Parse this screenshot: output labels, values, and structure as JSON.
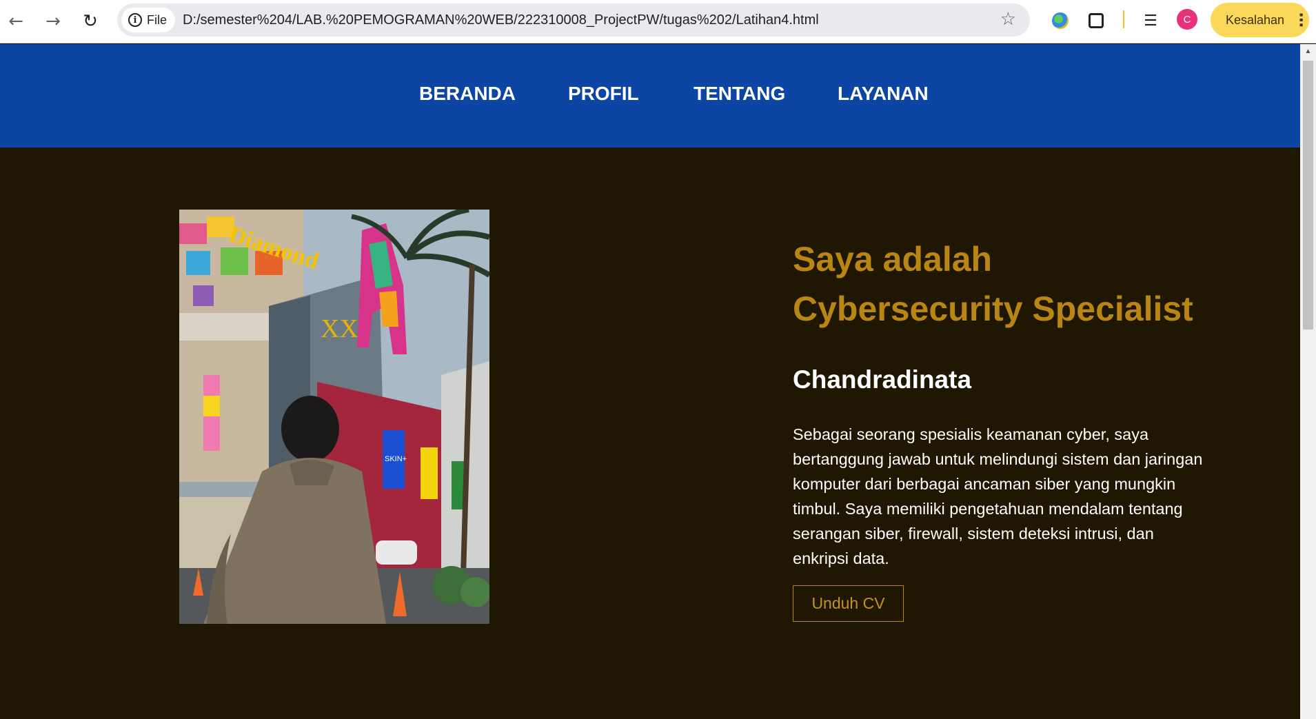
{
  "browser": {
    "back_icon": "arrow-left",
    "forward_icon": "arrow-right",
    "reload_icon": "reload",
    "site_chip_label": "File",
    "url": "D:/semester%204/LAB.%20PEMOGRAMAN%20WEB/222310008_ProjectPW/tugas%202/Latihan4.html",
    "profile_initial": "C",
    "error_label": "Kesalahan"
  },
  "nav": {
    "items": [
      {
        "label": "BERANDA"
      },
      {
        "label": "PROFIL"
      },
      {
        "label": "TENTANG"
      },
      {
        "label": "LAYANAN"
      }
    ]
  },
  "hero": {
    "title_line1": "Saya adalah",
    "title_line2": "Cybersecurity Specialist",
    "name": "Chandradinata",
    "description": "Sebagai seorang spesialis keamanan cyber, saya bertanggung jawab untuk melindungi sistem dan jaringan komputer dari berbagai ancaman siber yang mungkin timbul. Saya memiliki pengetahuan mendalam tentang serangan siber, firewall, sistem deteksi intrusi, dan enkripsi data.",
    "cv_button": "Unduh CV",
    "photo_signs": {
      "mall_sign": "Diamond",
      "cinema_sign": "XXI",
      "billboard": "SKIN+"
    }
  },
  "colors": {
    "nav_bg": "#0d45a5",
    "page_bg": "#201703",
    "accent": "#b98614",
    "text": "#ffffff"
  }
}
